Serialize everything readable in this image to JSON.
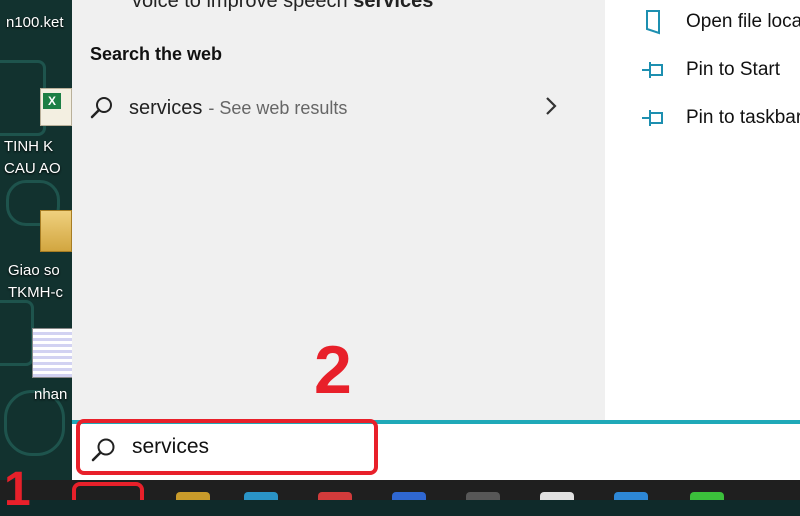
{
  "desktop": {
    "icons": [
      {
        "label_lines": [
          "n100.ket"
        ]
      },
      {
        "label_lines": [
          "TINH K",
          "CAU AO"
        ]
      },
      {
        "label_lines": [
          "Giao so",
          "TKMH-c"
        ]
      },
      {
        "label_lines": [
          "nhan"
        ]
      }
    ]
  },
  "search_panel": {
    "top_partial_text_prefix": "voice to improve speech ",
    "top_partial_text_bold": "services",
    "web_section_heading": "Search the web",
    "web_result": {
      "query": "services",
      "suffix": " - See web results"
    },
    "context_actions": [
      {
        "icon": "open-file-location-icon",
        "label": "Open file loca"
      },
      {
        "icon": "pin-icon",
        "label": "Pin to Start"
      },
      {
        "icon": "pin-icon",
        "label": "Pin to taskbar"
      }
    ]
  },
  "search_box": {
    "value": "services"
  },
  "annotations": {
    "step1": "1",
    "step2": "2",
    "highlight_color": "#e8202a"
  },
  "colors": {
    "accent": "#20a9b8",
    "panel_left": "#f0f0f0",
    "panel_right": "#ffffff",
    "taskbar": "#1f1f1f"
  }
}
